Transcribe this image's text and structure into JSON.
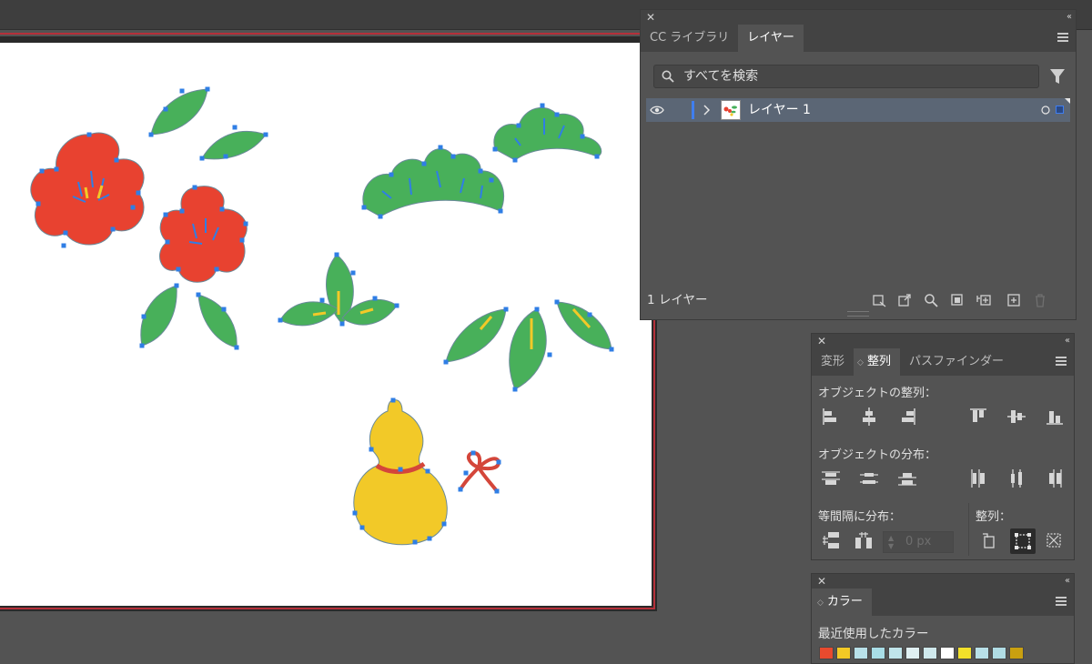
{
  "layers_panel": {
    "tabs": [
      "CC ライブラリ",
      "レイヤー"
    ],
    "active_tab": "レイヤー",
    "search_placeholder": "すべてを検索",
    "layers": [
      {
        "name": "レイヤー 1",
        "visible": true
      }
    ],
    "footer_count": "1 レイヤー"
  },
  "align_panel": {
    "tabs": [
      "変形",
      "整列",
      "パスファインダー"
    ],
    "active_tab": "整列",
    "align_objects_label": "オブジェクトの整列：",
    "distribute_objects_label": "オブジェクトの分布：",
    "distribute_spacing_label": "等間隔に分布：",
    "align_to_label": "整列：",
    "spacing_value": "0 px"
  },
  "color_panel": {
    "tab": "カラー",
    "recent_label": "最近使用したカラー",
    "recent_swatches": [
      "#e84a2e",
      "#f2c925",
      "#b8e0e8",
      "#a8dde6",
      "#c0e4ea",
      "#e0f0f2",
      "#cfe8ec",
      "#ffffff",
      "#f2e02a",
      "#b8e0e8",
      "#b0dce4",
      "#c9a010"
    ]
  },
  "colors": {
    "flower_red": "#e84230",
    "leaf_green": "#48b05a",
    "gourd_yellow": "#f2c928",
    "anchor_blue": "#2f7ee5",
    "artboard_border": "#b5303a"
  }
}
